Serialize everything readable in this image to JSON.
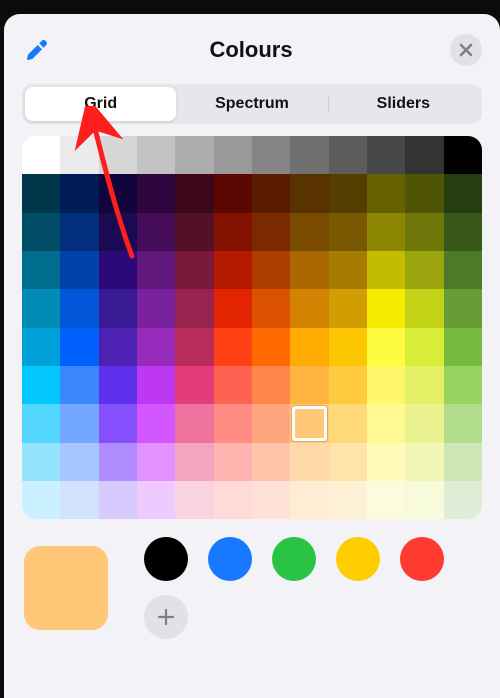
{
  "header": {
    "title": "Colours",
    "eyedropper_icon": "eyedropper",
    "close_icon": "close"
  },
  "tabs": {
    "items": [
      {
        "label": "Grid",
        "active": true
      },
      {
        "label": "Spectrum",
        "active": false
      },
      {
        "label": "Sliders",
        "active": false
      }
    ]
  },
  "grid": {
    "cols": 12,
    "rows": 10,
    "selected": {
      "row": 7,
      "col": 7
    },
    "rows_data": [
      [
        "#ffffff",
        "#ebebeb",
        "#d6d6d6",
        "#c2c2c2",
        "#adadad",
        "#999999",
        "#858585",
        "#707070",
        "#5c5c5c",
        "#474747",
        "#333333",
        "#000000"
      ],
      [
        "#00374a",
        "#011d57",
        "#11053b",
        "#2e063d",
        "#3c071b",
        "#5c0701",
        "#5a1c00",
        "#583300",
        "#563d00",
        "#666100",
        "#4f5504",
        "#263e0f"
      ],
      [
        "#004d65",
        "#012f7b",
        "#1a0a52",
        "#450d59",
        "#551029",
        "#831100",
        "#7b2900",
        "#7a4a00",
        "#785800",
        "#8d8602",
        "#6f760a",
        "#38571a"
      ],
      [
        "#016e8f",
        "#0042a9",
        "#2c0977",
        "#61187c",
        "#791a3d",
        "#b51a00",
        "#ad3e00",
        "#a96800",
        "#a67b01",
        "#c4bc00",
        "#9ba50e",
        "#4e7a27"
      ],
      [
        "#008cb4",
        "#0056d6",
        "#371a94",
        "#7a219e",
        "#99244f",
        "#e22400",
        "#da5100",
        "#d38301",
        "#d19d01",
        "#f5ec00",
        "#c3d117",
        "#669d34"
      ],
      [
        "#00a1d8",
        "#0061fd",
        "#4d22b2",
        "#982abc",
        "#b92d5d",
        "#ff4015",
        "#ff6a00",
        "#ffab01",
        "#fcc700",
        "#fefb41",
        "#d9ec37",
        "#76bb40"
      ],
      [
        "#01c7fc",
        "#3a87fd",
        "#5e30eb",
        "#be38f3",
        "#e63b7a",
        "#fe6250",
        "#ff8648",
        "#feb43f",
        "#fecb3e",
        "#fff76b",
        "#e4ef65",
        "#96d35f"
      ],
      [
        "#52d6fc",
        "#74a7ff",
        "#864ffe",
        "#d357fe",
        "#ee719e",
        "#ff8c82",
        "#ffa57d",
        "#ffc777",
        "#ffd977",
        "#fff994",
        "#eaf28f",
        "#b1dd8b"
      ],
      [
        "#93e3fc",
        "#a7c6ff",
        "#b18cfe",
        "#e292fe",
        "#f4a4c0",
        "#ffb5af",
        "#ffc5ab",
        "#ffd9a8",
        "#fee4a8",
        "#fffbb9",
        "#f2f7b7",
        "#cde8b5"
      ],
      [
        "#cbf0ff",
        "#d2e2fe",
        "#d8c9fe",
        "#efcafe",
        "#f9d3e0",
        "#ffdad8",
        "#ffe2d6",
        "#ffecd4",
        "#fef1d5",
        "#fdfbdd",
        "#f7fadb",
        "#deedd6"
      ]
    ]
  },
  "swatch": {
    "current": "#ffc777",
    "presets": [
      "#000000",
      "#1779ff",
      "#2ac445",
      "#ffcc00",
      "#ff3b30"
    ],
    "add_icon": "plus"
  },
  "annotation": {
    "arrow_color": "#ff1e1e",
    "target": "tab-grid"
  }
}
